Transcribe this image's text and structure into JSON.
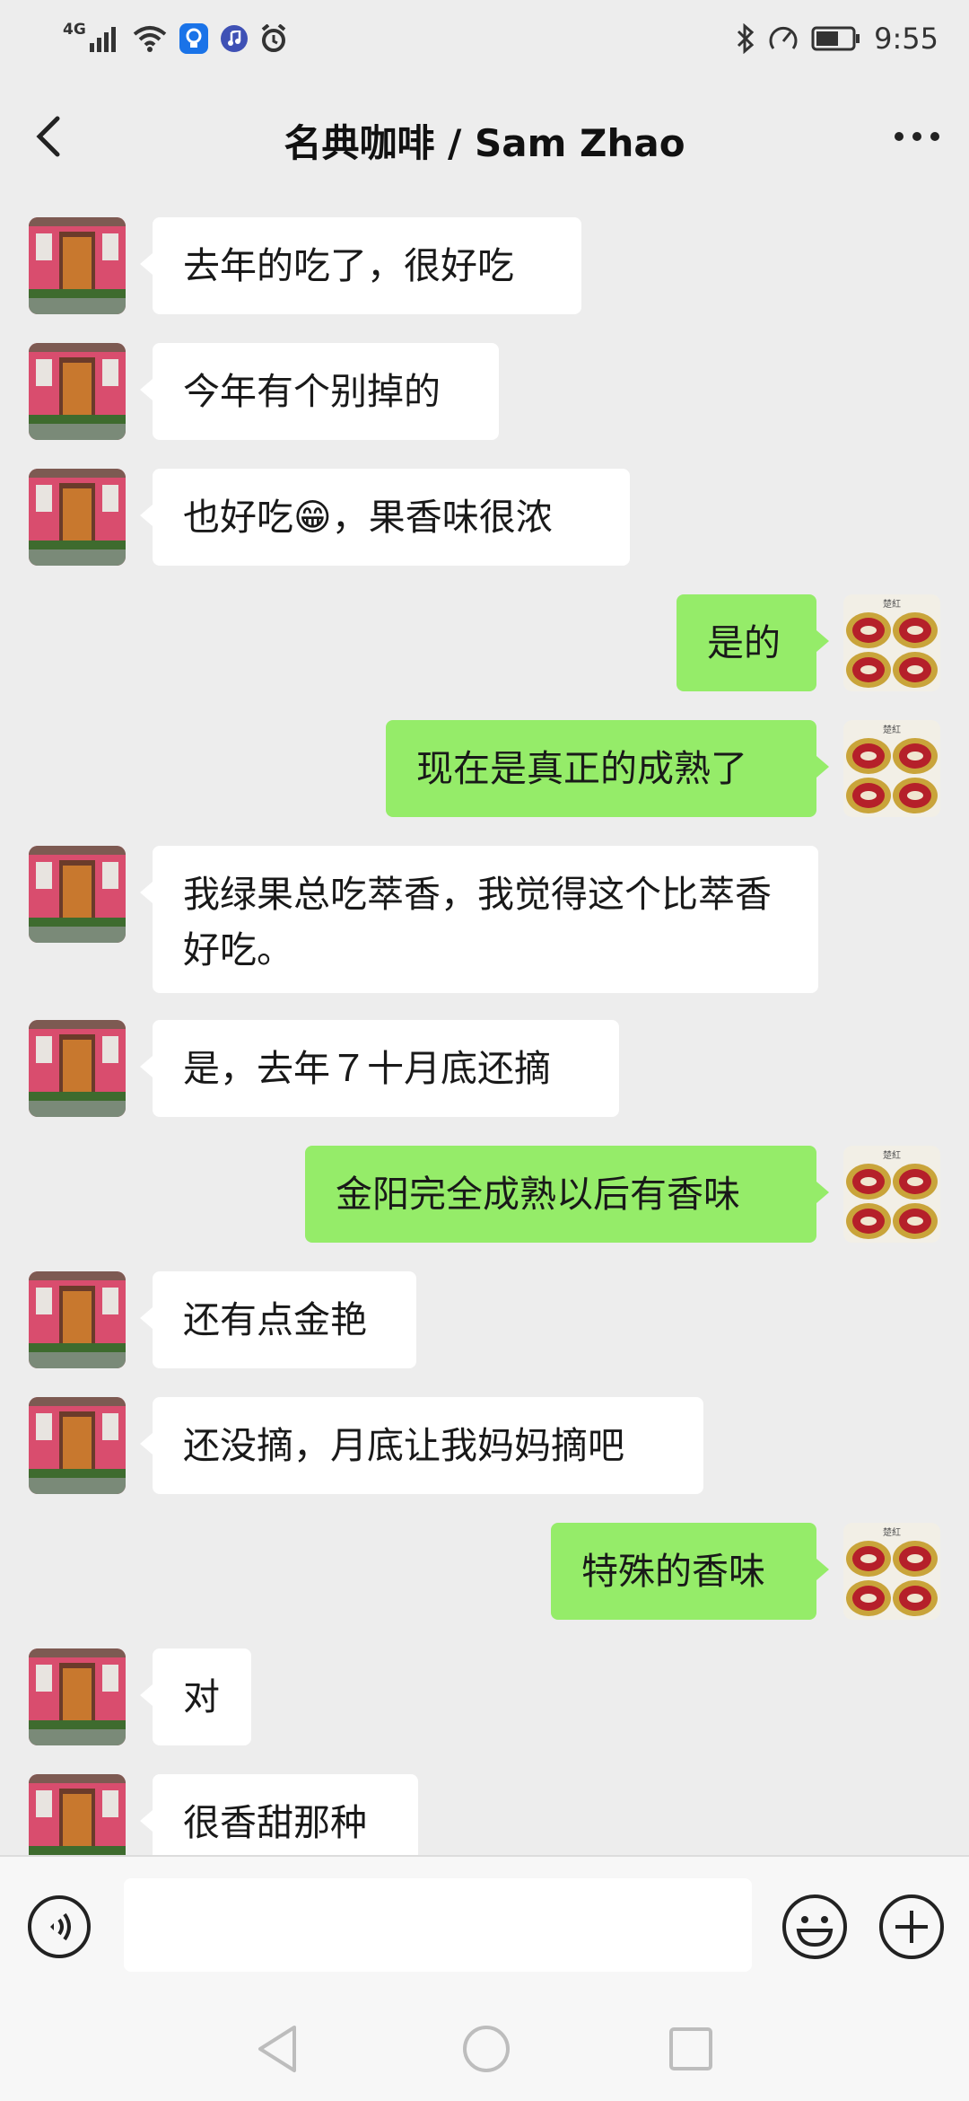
{
  "status_bar": {
    "network_label": "4G",
    "time": "9:55"
  },
  "header": {
    "title": "名典咖啡 / Sam Zhao"
  },
  "messages": [
    {
      "side": "left",
      "text": "去年的吃了，很好吃"
    },
    {
      "side": "left",
      "text": "今年有个别掉的"
    },
    {
      "side": "left",
      "text": "也好吃😁，果香味很浓"
    },
    {
      "side": "right",
      "text": "是的"
    },
    {
      "side": "right",
      "text": "现在是真正的成熟了"
    },
    {
      "side": "left",
      "text": "我绿果总吃萃香，我觉得这个比萃香好吃。"
    },
    {
      "side": "left",
      "text": "是，去年７十月底还摘"
    },
    {
      "side": "right",
      "text": "金阳完全成熟以后有香味"
    },
    {
      "side": "left",
      "text": "还有点金艳"
    },
    {
      "side": "left",
      "text": "还没摘，月底让我妈妈摘吧"
    },
    {
      "side": "right",
      "text": "特殊的香味"
    },
    {
      "side": "left",
      "text": "对"
    },
    {
      "side": "left",
      "text": "很香甜那种"
    }
  ],
  "input_bar": {
    "text_value": ""
  },
  "colors": {
    "background": "#ededed",
    "incoming_bubble": "#ffffff",
    "outgoing_bubble": "#95ec69"
  },
  "icons": {
    "status": [
      "signal-icon",
      "wifi-icon",
      "app-notification-icon",
      "music-icon",
      "alarm-icon",
      "bluetooth-icon",
      "vibrate-icon",
      "battery-icon"
    ],
    "nav": [
      "back-arrow-icon",
      "more-dots-icon"
    ],
    "input": [
      "voice-icon",
      "emoji-icon",
      "plus-icon"
    ],
    "system": [
      "system-back-icon",
      "system-home-icon",
      "system-recent-icon"
    ]
  }
}
